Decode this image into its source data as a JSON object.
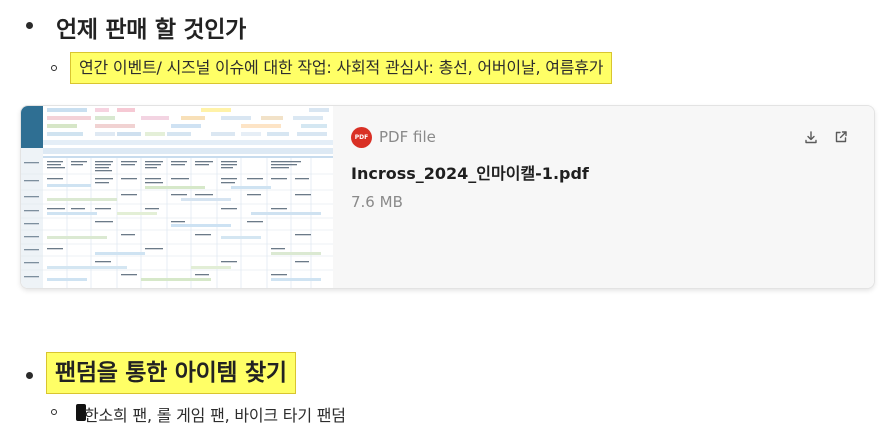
{
  "section1": {
    "heading": "언제 판매 할 것인가",
    "subitem": "연간 이벤트/ 시즈널 이슈에 대한 작업: 사회적 관심사: 총선, 어버이날, 여름휴가"
  },
  "attachment": {
    "file_type": "PDF file",
    "file_name": "Incross_2024_인마이캘-1.pdf",
    "file_size": "7.6 MB",
    "icon": "pdf-icon",
    "icon_label": "PDF",
    "actions": [
      "download-icon",
      "open-external-icon"
    ],
    "accent_color": "#d93025"
  },
  "section2": {
    "heading": "팬덤을 통한 아이템 찾기",
    "subitem": "한소희 팬, 롤 게임 팬, 바이크 타기 팬덤"
  },
  "colors": {
    "highlight": "#ffff66",
    "text": "#2d2d2d"
  }
}
